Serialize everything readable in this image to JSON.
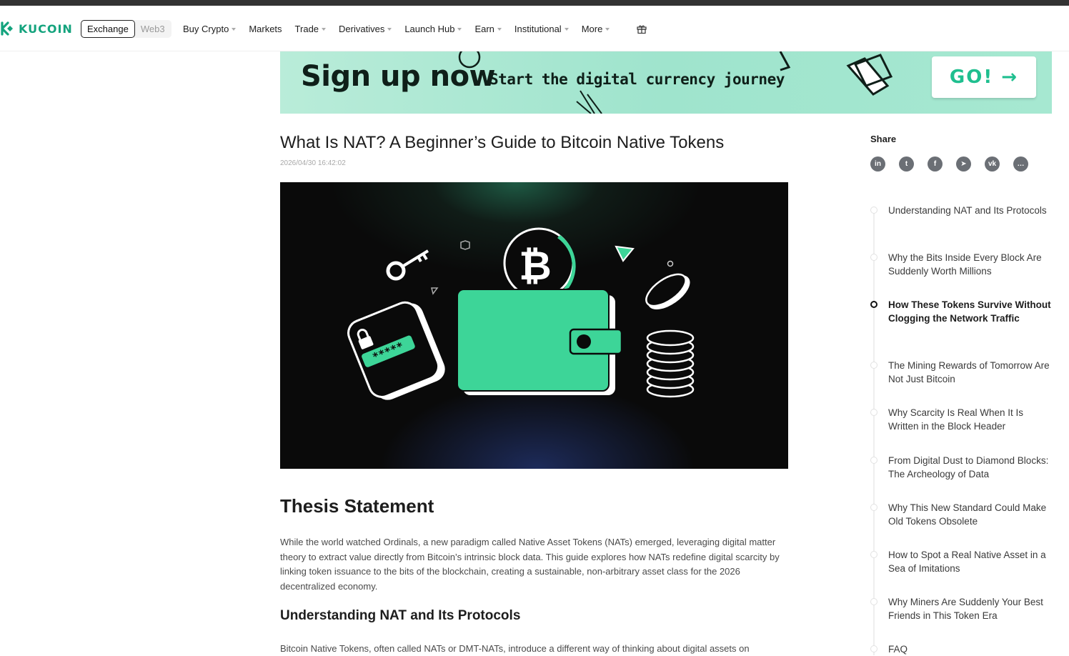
{
  "nav": {
    "logo_text": "KUCOIN",
    "brand_color": "#13a37d",
    "segment": {
      "exchange": "Exchange",
      "web3": "Web3"
    },
    "items": [
      {
        "label": "Buy Crypto",
        "has_caret": true
      },
      {
        "label": "Markets",
        "has_caret": false
      },
      {
        "label": "Trade",
        "has_caret": true
      },
      {
        "label": "Derivatives",
        "has_caret": true
      },
      {
        "label": "Launch Hub",
        "has_caret": true
      },
      {
        "label": "Earn",
        "has_caret": true
      },
      {
        "label": "Institutional",
        "has_caret": true
      },
      {
        "label": "More",
        "has_caret": true
      }
    ],
    "gift_icon": "gift-icon"
  },
  "banner": {
    "title": "Sign up now",
    "subtitle": "Start the digital currency journey",
    "button": "GO! →",
    "accent": "#1fbf8f"
  },
  "article": {
    "title": "What Is NAT? A Beginner’s Guide to Bitcoin Native Tokens",
    "date": "2026/04/30 16:42:02",
    "hero_image": "wallet-with-bitcoin-illustration",
    "sections": [
      {
        "heading": "Thesis Statement",
        "text": "While the world watched Ordinals, a new paradigm called Native Asset Tokens (NATs) emerged, leveraging digital matter theory to extract value directly from Bitcoin’s intrinsic block data. This guide explores how NATs redefine digital scarcity by linking token issuance to the bits of the blockchain, creating a sustainable, non-arbitrary asset class for the 2026 decentralized economy."
      },
      {
        "heading": "Understanding NAT and Its Protocols",
        "text": "Bitcoin Native Tokens, often called NATs or DMT-NATs, introduce a different way of thinking about digital assets on"
      }
    ]
  },
  "share": {
    "label": "Share",
    "icons": [
      "linkedin-icon",
      "twitter-icon",
      "facebook-icon",
      "telegram-icon",
      "vk-icon",
      "line-icon"
    ],
    "glyphs": [
      "in",
      "t",
      "f",
      "➤",
      "vk",
      "…"
    ]
  },
  "toc": {
    "active_index": 2,
    "items": [
      "Understanding NAT and Its Protocols",
      "Why the Bits Inside Every Block Are Suddenly Worth Millions",
      "How These Tokens Survive Without Clogging the Network Traffic",
      "The Mining Rewards of Tomorrow Are Not Just Bitcoin",
      "Why Scarcity Is Real When It Is Written in the Block Header",
      "From Digital Dust to Diamond Blocks: The Archeology of Data",
      "Why This New Standard Could Make Old Tokens Obsolete",
      "How to Spot a Real Native Asset in a Sea of Imitations",
      "Why Miners Are Suddenly Your Best Friends in This Token Era",
      "FAQ"
    ]
  }
}
